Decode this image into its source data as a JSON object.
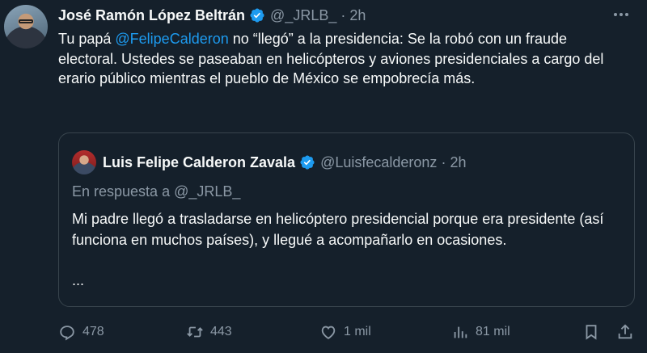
{
  "tweet": {
    "author_name": "José Ramón López Beltrán",
    "handle": "@_JRLB_",
    "separator": "·",
    "time": "2h",
    "text_before_mention": "Tu papá ",
    "mention": "@FelipeCalderon",
    "text_after_mention": " no “llegó” a la presidencia: Se la robó con un fraude electoral. Ustedes se paseaban en helicópteros y aviones presidenciales a cargo del erario público mientras el pueblo de México se empobrecía más."
  },
  "quoted_tweet": {
    "author_name": "Luis Felipe Calderon Zavala",
    "handle": "@Luisfecalderonz",
    "separator": "·",
    "time": "2h",
    "reply_to": "En respuesta a @_JRLB_",
    "text": "Mi padre llegó a trasladarse en helicóptero presidencial porque era presidente (así funciona en muchos países), y llegué a acompañarlo en ocasiones.",
    "ellipsis": "..."
  },
  "actions": {
    "replies": "478",
    "retweets": "443",
    "likes": "1 mil",
    "views": "81 mil"
  },
  "colors": {
    "background": "#15202b",
    "accent": "#1d9bf0",
    "muted": "#8b98a5"
  },
  "icons": [
    "verified-badge-icon",
    "more-icon",
    "reply-icon",
    "retweet-icon",
    "like-icon",
    "views-icon",
    "bookmark-icon",
    "share-icon"
  ]
}
